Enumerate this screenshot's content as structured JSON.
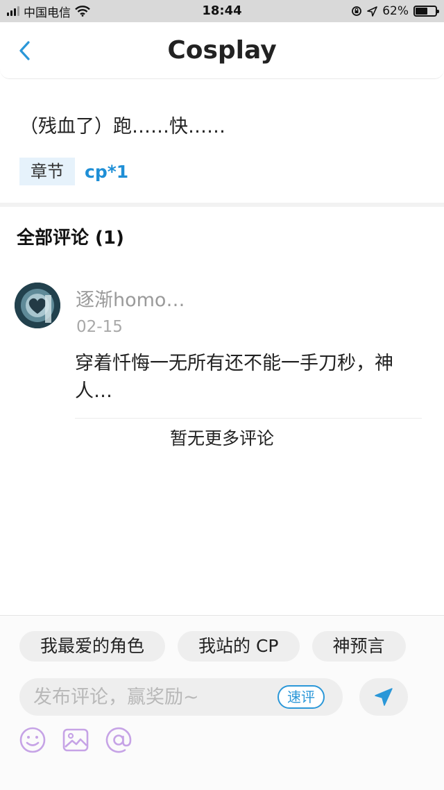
{
  "status_bar": {
    "carrier": "中国电信",
    "time": "18:44",
    "battery": "62%",
    "battery_level": 0.62
  },
  "header": {
    "title": "Cosplay"
  },
  "post": {
    "text": "（残血了）跑……快……",
    "tag_chip": "章节",
    "tag_link": "cp*1"
  },
  "comments": {
    "title": "全部评论 (1)",
    "items": [
      {
        "name": "逐渐homo…",
        "date": "02-15",
        "body": "穿着忏悔一无所有还不能一手刀秒，神人…"
      }
    ],
    "no_more": "暂无更多评论"
  },
  "composer": {
    "chips": [
      "我最爱的角色",
      "我站的 CP",
      "神预言"
    ],
    "placeholder": "发布评论，赢奖励~",
    "quick_review": "速评"
  },
  "colors": {
    "accent": "#2a97d8",
    "tag_bg": "#e6f2fb",
    "tool_icon": "#c6a3e6"
  }
}
